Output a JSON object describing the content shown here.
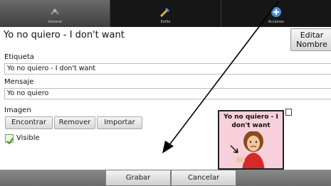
{
  "tabs": [
    {
      "label": "General",
      "icon": "general-icon",
      "selected": true
    },
    {
      "label": "Estilo",
      "icon": "style-icon",
      "selected": false
    },
    {
      "label": "Acciones",
      "icon": "actions-icon",
      "selected": false
    }
  ],
  "header": {
    "title": "Yo no quiero - I don't want",
    "edit_button": "Editar Nombre"
  },
  "form": {
    "tag_label": "Etiqueta",
    "tag_value": "Yo no quiero - I don't want",
    "message_label": "Mensaje",
    "message_value": "Yo no quiero",
    "image_label": "Imagen",
    "find_button": "Encontrar",
    "remove_button": "Remover",
    "import_button": "Importar",
    "visible_label": "Visible",
    "visible_checked": true
  },
  "card": {
    "text": "Yo no quiero - I don't want",
    "background": "#f8d0dc"
  },
  "footer": {
    "save_button": "Grabar",
    "cancel_button": "Cancelar"
  },
  "colors": {
    "tabbar_bg": "#161616",
    "check_green": "#3a9a1a"
  }
}
